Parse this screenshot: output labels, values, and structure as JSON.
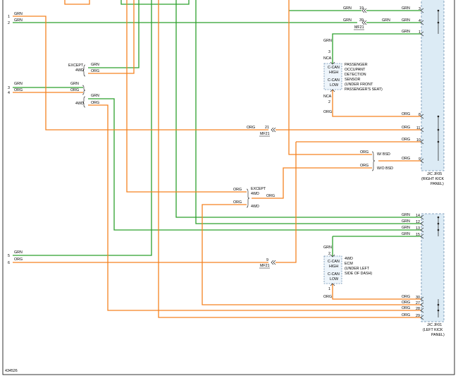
{
  "colors": {
    "green_wire": "#2ca02c",
    "orange_wire": "#f58220",
    "connector_fill": "#dcebf5",
    "connector_stroke": "#6b8fb0",
    "module_stroke": "#6b8fb0",
    "border": "#000000"
  },
  "left_pins": {
    "p1": {
      "num": "1",
      "label": "GRN"
    },
    "p2": {
      "num": "2",
      "label": "GRN"
    },
    "p3": {
      "num": "3",
      "label": "GRN"
    },
    "p4": {
      "num": "4",
      "label": "ORG"
    },
    "p5": {
      "num": "5",
      "label": "GRN"
    },
    "p6": {
      "num": "6",
      "label": "ORG"
    }
  },
  "splices": {
    "s1": {
      "top": "EXCEPT",
      "bottom": "4WD"
    },
    "s1_wires": [
      "GRN",
      "ORG"
    ],
    "s2_wires": [
      "GRN",
      "ORG"
    ],
    "s2_label": "4WD",
    "s3": {
      "top": "EXCEPT",
      "bottom": "4WD"
    },
    "s3_wires": [
      "ORG",
      "ORG"
    ],
    "s3_out": "ORG",
    "s3_bottom": "4WD",
    "s4_wires": [
      "ORG",
      "ORG"
    ],
    "s4_labels": [
      "W/ BSD",
      "W/O BSD"
    ]
  },
  "inline_connectors": {
    "mf21_upper": {
      "pin": "21",
      "wire": "ORG",
      "name": "MF21"
    },
    "mf21_lower": {
      "pin": "9",
      "wire": "",
      "name": "MF21"
    },
    "mf21_top": {
      "pin_a": "19",
      "pin_b": "39",
      "wire_a": "GRN",
      "wire_b": "GRN",
      "name": "MF21"
    }
  },
  "jf05": {
    "name": "J/C JF05",
    "desc1": "(RIGHT KICK",
    "desc2": "PANEL)",
    "pins": [
      {
        "num": "3",
        "wire": "GRN"
      },
      {
        "num": "4",
        "wire": "GRN"
      },
      {
        "num": "1",
        "wire": "GRN"
      },
      {
        "num": "8",
        "wire": "ORG"
      },
      {
        "num": "11",
        "wire": "ORG"
      },
      {
        "num": "10",
        "wire": "ORG"
      },
      {
        "num": "9",
        "wire": "ORG"
      }
    ],
    "mid_wire_label": "GRN"
  },
  "jf01": {
    "name": "J/C JF01",
    "desc1": "(LEFT KICK",
    "desc2": "PANEL)",
    "pins": [
      {
        "num": "14",
        "wire": "GRN"
      },
      {
        "num": "12",
        "wire": "GRN"
      },
      {
        "num": "13",
        "wire": "GRN"
      },
      {
        "num": "15",
        "wire": "GRN"
      },
      {
        "num": "30",
        "wire": "ORG"
      },
      {
        "num": "27",
        "wire": "ORG"
      },
      {
        "num": "28",
        "wire": "ORG"
      },
      {
        "num": "29",
        "wire": "ORG"
      }
    ]
  },
  "occupant_sensor": {
    "pin_top": "3",
    "pin_top_wire": "GRN",
    "nca_top": "NCA",
    "high": "C-CAN\nHIGH",
    "low": "C-CAN\nLOW",
    "high_l1": "C-CAN",
    "high_l2": "HIGH",
    "low_l1": "C-CAN",
    "low_l2": "LOW",
    "nca_bottom": "NCA",
    "pin_bottom": "2",
    "pin_bottom_wire": "ORG",
    "name_lines": [
      "PASSENGER",
      "OCCUPANT",
      "DETECTION",
      "SENSOR",
      "(UNDER FRONT",
      "PASSENGER'S SEAT)"
    ]
  },
  "ecm_4wd": {
    "pin_top": "2",
    "pin_top_wire": "GRN",
    "high_l1": "C-CAN",
    "high_l2": "HIGH",
    "low_l1": "C-CAN",
    "low_l2": "LOW",
    "pin_bottom": "1",
    "pin_bottom_wire": "ORG",
    "name_lines": [
      "4WD",
      "ECM",
      "(UNDER LEFT",
      "SIDE OF DASH)"
    ]
  },
  "reference_id": "434526"
}
